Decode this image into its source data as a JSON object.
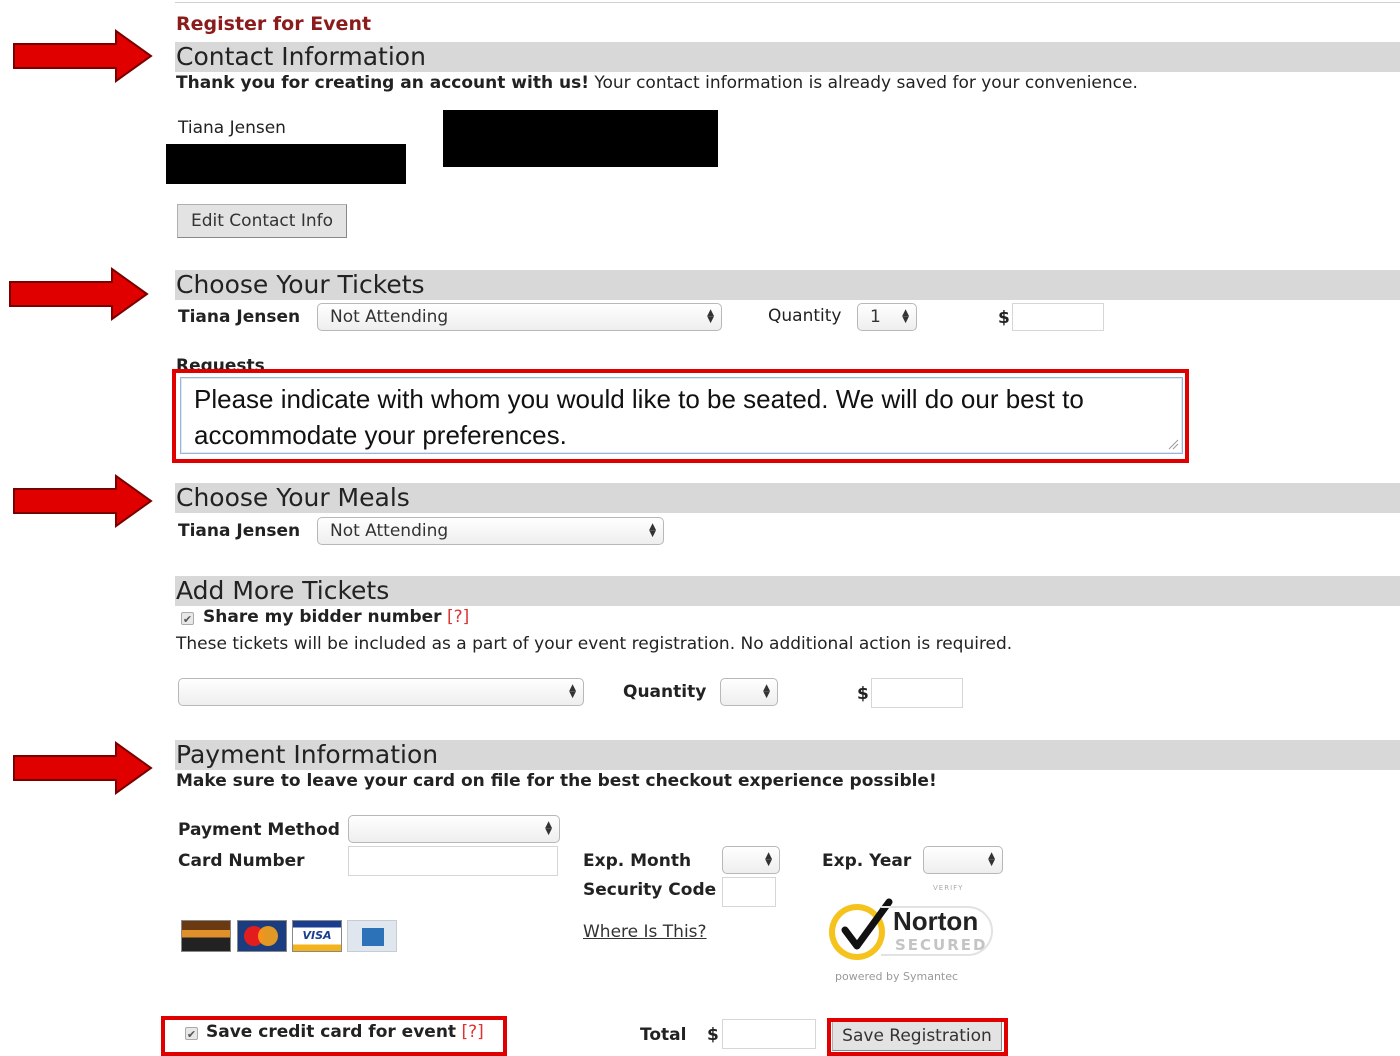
{
  "page": {
    "title": "Register for Event"
  },
  "contact": {
    "section_title": "Contact Information",
    "thank_you_bold": "Thank you for creating an account with us!",
    "thank_you_rest": "Your contact information is already saved for your convenience.",
    "name": "Tiana Jensen",
    "edit_button": "Edit Contact Info"
  },
  "tickets": {
    "section_title": "Choose Your Tickets",
    "attendee_name": "Tiana Jensen",
    "ticket_select": "Not Attending",
    "quantity_label": "Quantity",
    "quantity_value": "1",
    "price_symbol": "$",
    "requests_label": "Requests",
    "requests_text": "Please indicate with whom you would like to be seated.  We will do our best to accommodate your preferences."
  },
  "meals": {
    "section_title": "Choose Your Meals",
    "attendee_name": "Tiana Jensen",
    "meal_select": "Not Attending"
  },
  "add_tickets": {
    "section_title": "Add More Tickets",
    "share_bidder_label": "Share my bidder number",
    "help_marker": "[?]",
    "note": "These tickets will be included as a part of your event registration. No additional action is required.",
    "ticket_select": "",
    "quantity_label": "Quantity",
    "price_symbol": "$"
  },
  "payment": {
    "section_title": "Payment Information",
    "subtitle": "Make sure to leave your card on file for the best checkout experience possible!",
    "method_label": "Payment Method",
    "card_number_label": "Card Number",
    "exp_month_label": "Exp. Month",
    "exp_year_label": "Exp. Year",
    "security_code_label": "Security Code",
    "where_link": "Where Is This?",
    "norton_top": "VERIFY",
    "norton_brand": "Norton",
    "norton_secured": "SECURED",
    "norton_powered": "powered by Symantec",
    "save_card_label": "Save credit card for event",
    "help_marker": "[?]",
    "total_label": "Total",
    "total_symbol": "$",
    "save_button": "Save Registration"
  },
  "cards": [
    "discover-card-icon",
    "mastercard-icon",
    "visa-card-icon",
    "amex-card-icon"
  ],
  "colors": {
    "annotation_red": "#e10000",
    "title_red": "#8a1c1c",
    "section_bar": "#d8d8d8"
  }
}
